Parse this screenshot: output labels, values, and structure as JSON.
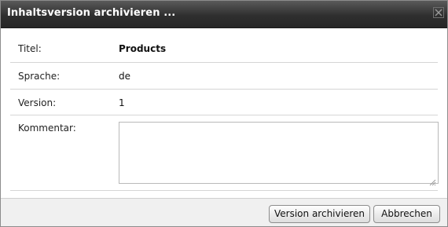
{
  "dialog": {
    "title": "Inhaltsversion archivieren ...",
    "close_icon": "close-icon"
  },
  "form": {
    "title_label": "Titel:",
    "title_value": "Products",
    "language_label": "Sprache:",
    "language_value": "de",
    "version_label": "Version:",
    "version_value": "1",
    "comment_label": "Kommentar:",
    "comment_value": ""
  },
  "buttons": {
    "archive_label": "Version archivieren",
    "cancel_label": "Abbrechen"
  }
}
